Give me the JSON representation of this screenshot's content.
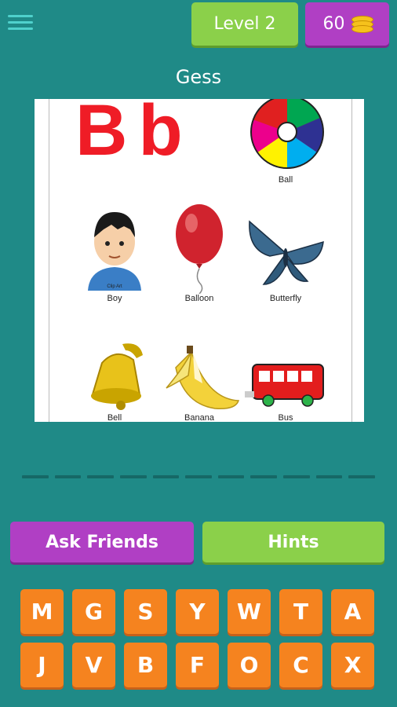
{
  "header": {
    "level_label": "Level 2",
    "coins": "60",
    "coin_icon": "coin-stack-icon"
  },
  "title": "Gess",
  "picture": {
    "letters": "Bb",
    "captions": [
      "Ball",
      "Boy",
      "Balloon",
      "Butterfly",
      "Bell",
      "Banana",
      "Bus"
    ],
    "badge_text": "Clip Art"
  },
  "answer_slot_count": 11,
  "actions": {
    "ask_friends": "Ask Friends",
    "hints": "Hints"
  },
  "keyboard": {
    "row1": [
      "M",
      "G",
      "S",
      "Y",
      "W",
      "T",
      "A"
    ],
    "row2": [
      "J",
      "V",
      "B",
      "F",
      "O",
      "C",
      "X"
    ]
  },
  "colors": {
    "background": "#1f8a87",
    "green": "#8bd04a",
    "purple": "#b03fc4",
    "orange": "#f5831f"
  }
}
